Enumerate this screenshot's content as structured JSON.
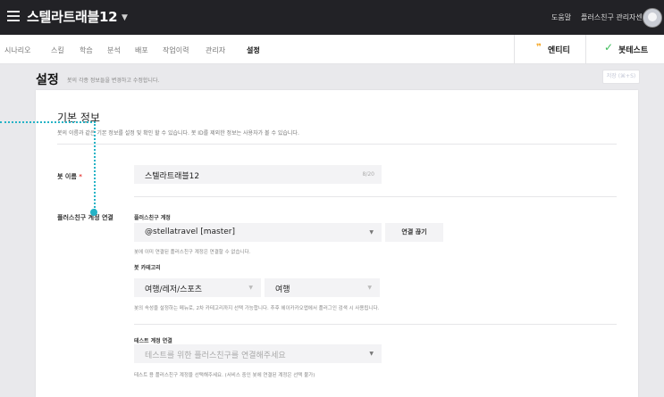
{
  "header": {
    "title": "스텔라트래블12",
    "help": "도움말",
    "partner_center": "플러스친구 관리자센터"
  },
  "tabs": [
    "시나리오",
    "스킬",
    "학습",
    "분석",
    "배포",
    "작업이력",
    "관리자",
    "설정"
  ],
  "active_tab": "설정",
  "actions": {
    "entity": "엔티티",
    "test": "봇테스트"
  },
  "page": {
    "title": "설정",
    "desc": "봇의 각종 정보들을 변경하고 수정합니다.",
    "save_label": "저장 (⌘+S)"
  },
  "basic": {
    "title": "기본 정보",
    "desc": "봇의 이름과 같은 기본 정보를 설정 및 확인 할 수 있습니다. 봇 ID를 제외한 정보는 사용자가 볼 수 있습니다.",
    "bot_name_label": "봇 이름",
    "required_mark": "*",
    "bot_name_value": "스텔라트래블12",
    "bot_name_count": "8/20"
  },
  "plusfriend": {
    "section_label": "플러스친구 계정 연결",
    "account_label": "플러스친구 계정",
    "account_value": "@stellatravel [master]",
    "unlink_label": "연결 끊기",
    "account_hint": "봇에 이미 연결된 플러스친구 계정은 연결할 수 없습니다.",
    "category_label": "봇 카테고리",
    "category1": "여행/레저/스포츠",
    "category2": "여행",
    "category_hint": "봇의 속성을 설정하는 메뉴로, 2차 카테고리까지 선택 가능합니다. 추후 헤이카카오앱에서 플러그인 검색 시 사용됩니다.",
    "test_label": "테스트 계정 연결",
    "test_placeholder": "테스트를 위한 플러스친구를 연결해주세요",
    "test_hint": "테스트 용 플러스친구 계정을 선택해주세요. (서비스 중인 봇에 연결된 계정은 선택 불가)"
  },
  "colors": {
    "topbar": "#222226",
    "guide": "#25b3c6",
    "required": "#e53935",
    "entity_icon": "#f5a623",
    "test_icon": "#3dbd5a"
  }
}
